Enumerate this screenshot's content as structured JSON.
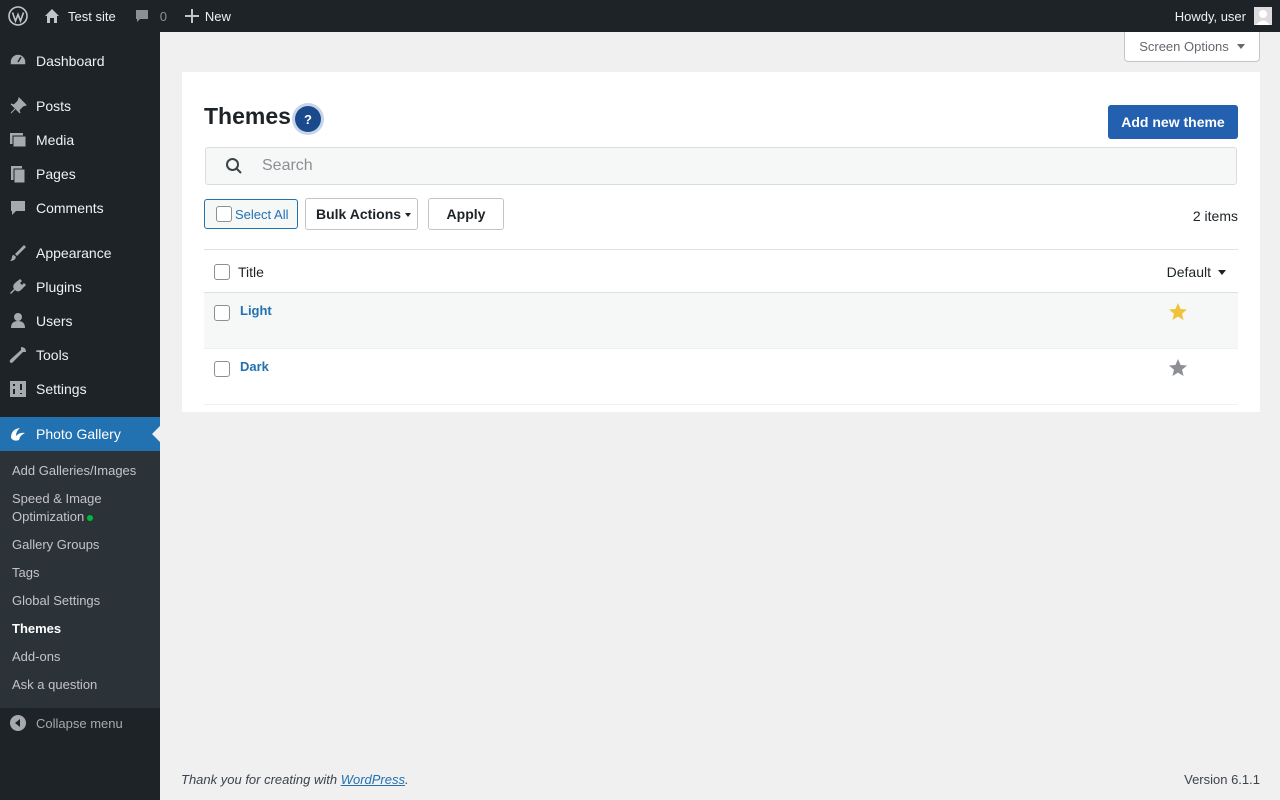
{
  "adminbar": {
    "site_name": "Test site",
    "comments_count": "0",
    "new_label": "New",
    "greeting": "Howdy, user"
  },
  "sidebar": {
    "items": [
      {
        "label": "Dashboard",
        "icon": "dashboard-icon"
      },
      {
        "label": "Posts",
        "icon": "pin-icon"
      },
      {
        "label": "Media",
        "icon": "media-icon"
      },
      {
        "label": "Pages",
        "icon": "pages-icon"
      },
      {
        "label": "Comments",
        "icon": "comment-icon"
      },
      {
        "label": "Appearance",
        "icon": "brush-icon"
      },
      {
        "label": "Plugins",
        "icon": "plug-icon"
      },
      {
        "label": "Users",
        "icon": "user-icon"
      },
      {
        "label": "Tools",
        "icon": "wrench-icon"
      },
      {
        "label": "Settings",
        "icon": "settings-icon"
      },
      {
        "label": "Photo Gallery",
        "icon": "photo-gallery-icon"
      }
    ],
    "submenu": [
      "Add Galleries/Images",
      "Speed & Image",
      "Optimization",
      "Gallery Groups",
      "Tags",
      "Global Settings",
      "Themes",
      "Add-ons",
      "Ask a question"
    ],
    "collapse_label": "Collapse menu"
  },
  "screen_options_label": "Screen Options",
  "main": {
    "title": "Themes",
    "help_label": "?",
    "add_button": "Add new theme",
    "search_placeholder": "Search",
    "select_all_label": "Select All",
    "bulk_actions_label": "Bulk Actions",
    "apply_label": "Apply",
    "items_count": "2 items",
    "columns": {
      "title": "Title",
      "default": "Default"
    },
    "rows": [
      {
        "name": "Light",
        "is_default": true
      },
      {
        "name": "Dark",
        "is_default": false
      }
    ]
  },
  "footer": {
    "thanks_prefix": "Thank you for creating with ",
    "thanks_link": "WordPress",
    "thanks_suffix": ".",
    "version": "Version 6.1.1"
  },
  "colors": {
    "accent": "#2271b1",
    "star_default": "#f0c33c",
    "star_inactive": "#8c8f94"
  }
}
